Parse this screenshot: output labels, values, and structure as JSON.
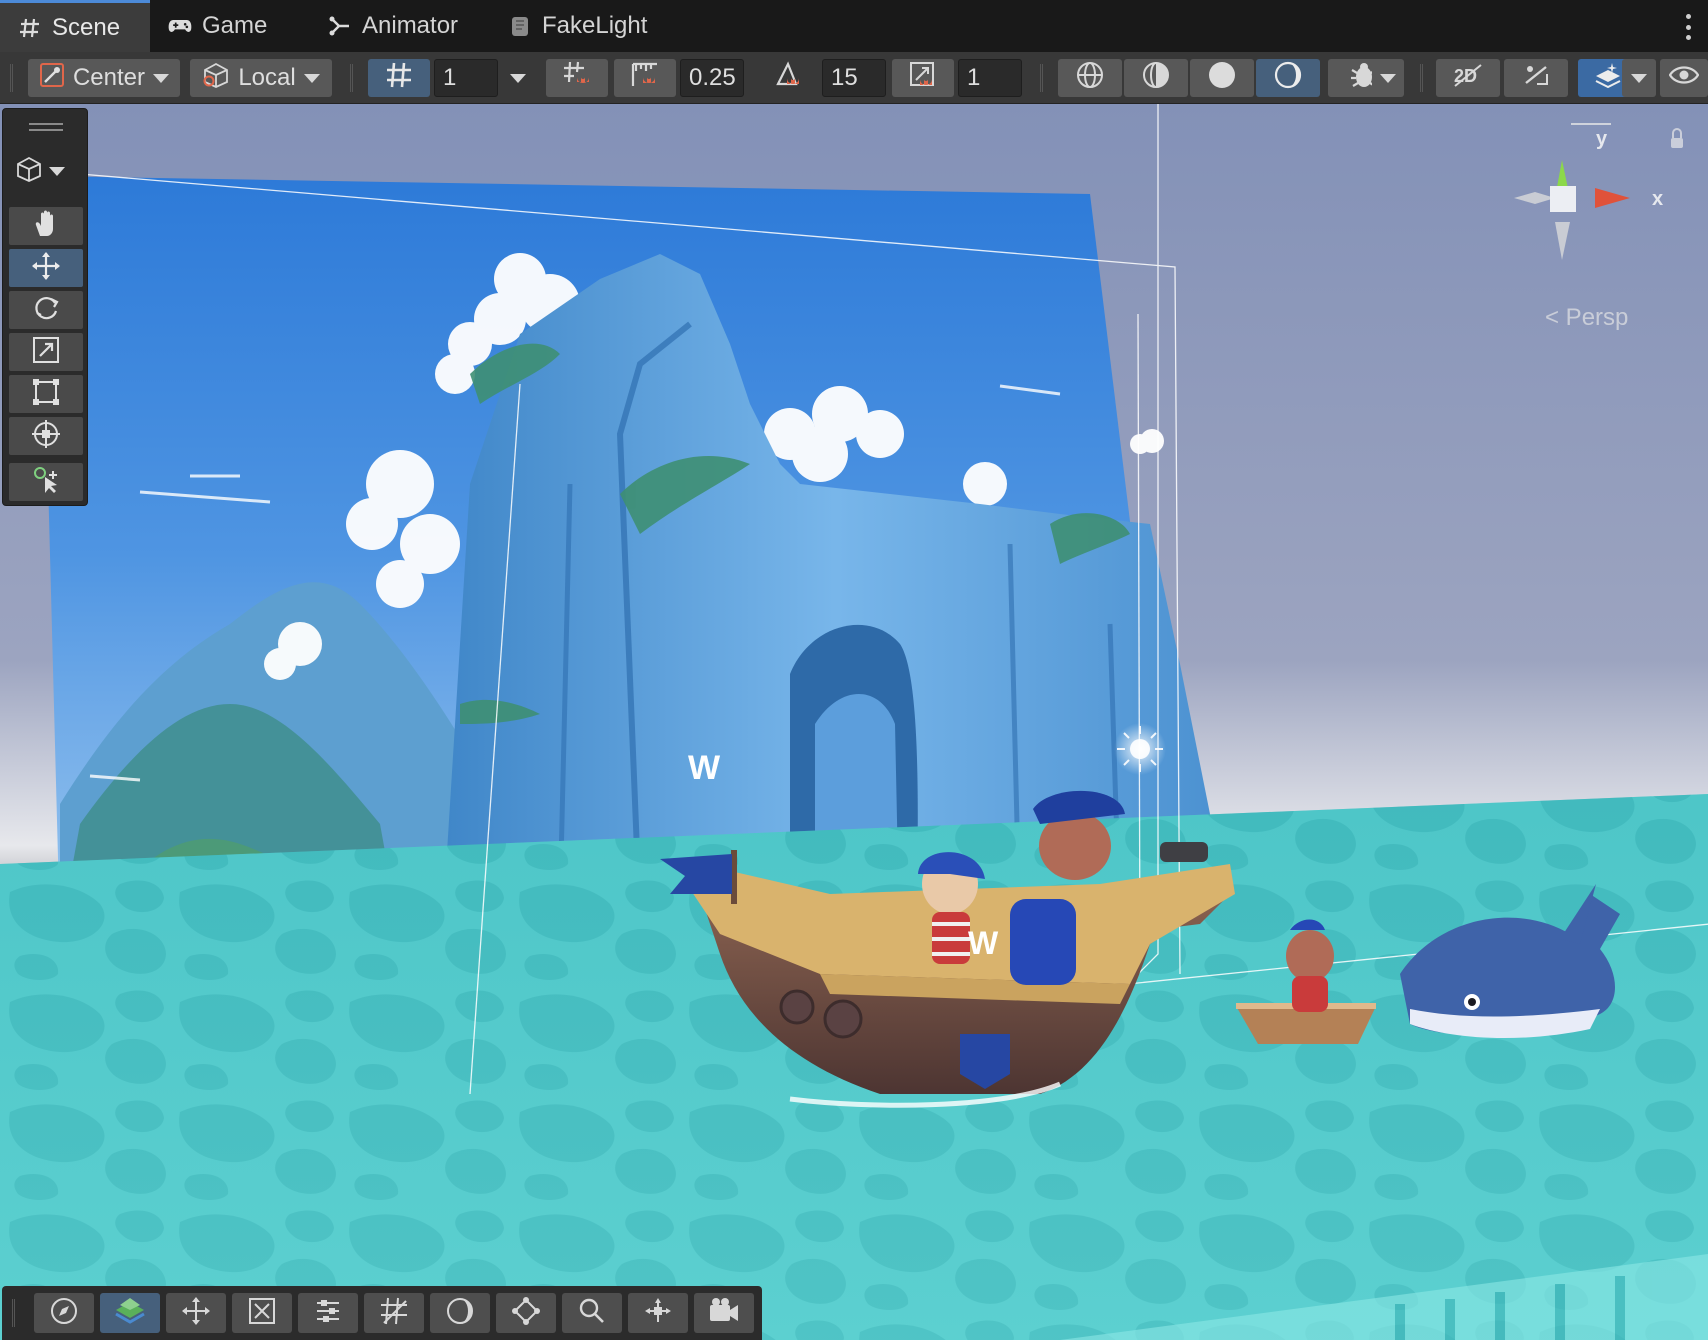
{
  "tabs": [
    {
      "label": "Scene",
      "icon": "grid-hash-icon",
      "active": true
    },
    {
      "label": "Game",
      "icon": "gamepad-icon",
      "active": false
    },
    {
      "label": "Animator",
      "icon": "animator-branch-icon",
      "active": false
    },
    {
      "label": "FakeLight",
      "icon": "puzzle-script-icon",
      "active": false
    }
  ],
  "toolbar": {
    "pivot_label": "Center",
    "space_label": "Local",
    "grid_size_value": "1",
    "move_snap_value": "0.25",
    "rotate_snap_value": "15",
    "scale_snap_value": "1"
  },
  "gizmo": {
    "y_label": "y",
    "x_label": "x",
    "projection_label": "< Persp"
  },
  "tools": [
    {
      "name": "view-tool",
      "icon": "hand-icon"
    },
    {
      "name": "move-tool",
      "icon": "move-arrows-icon",
      "active": true
    },
    {
      "name": "rotate-tool",
      "icon": "rotate-icon"
    },
    {
      "name": "scale-tool",
      "icon": "scale-icon"
    },
    {
      "name": "rect-tool",
      "icon": "rect-transform-icon"
    },
    {
      "name": "transform-tool",
      "icon": "transform-icon"
    },
    {
      "name": "custom-tool",
      "icon": "custom-editor-tool-icon"
    }
  ],
  "colors": {
    "accent_active": "#46607c",
    "toolbar_bg": "#383838",
    "tab_bg": "#191919",
    "axis_x": "#e0523a",
    "axis_y": "#8cd84a"
  }
}
